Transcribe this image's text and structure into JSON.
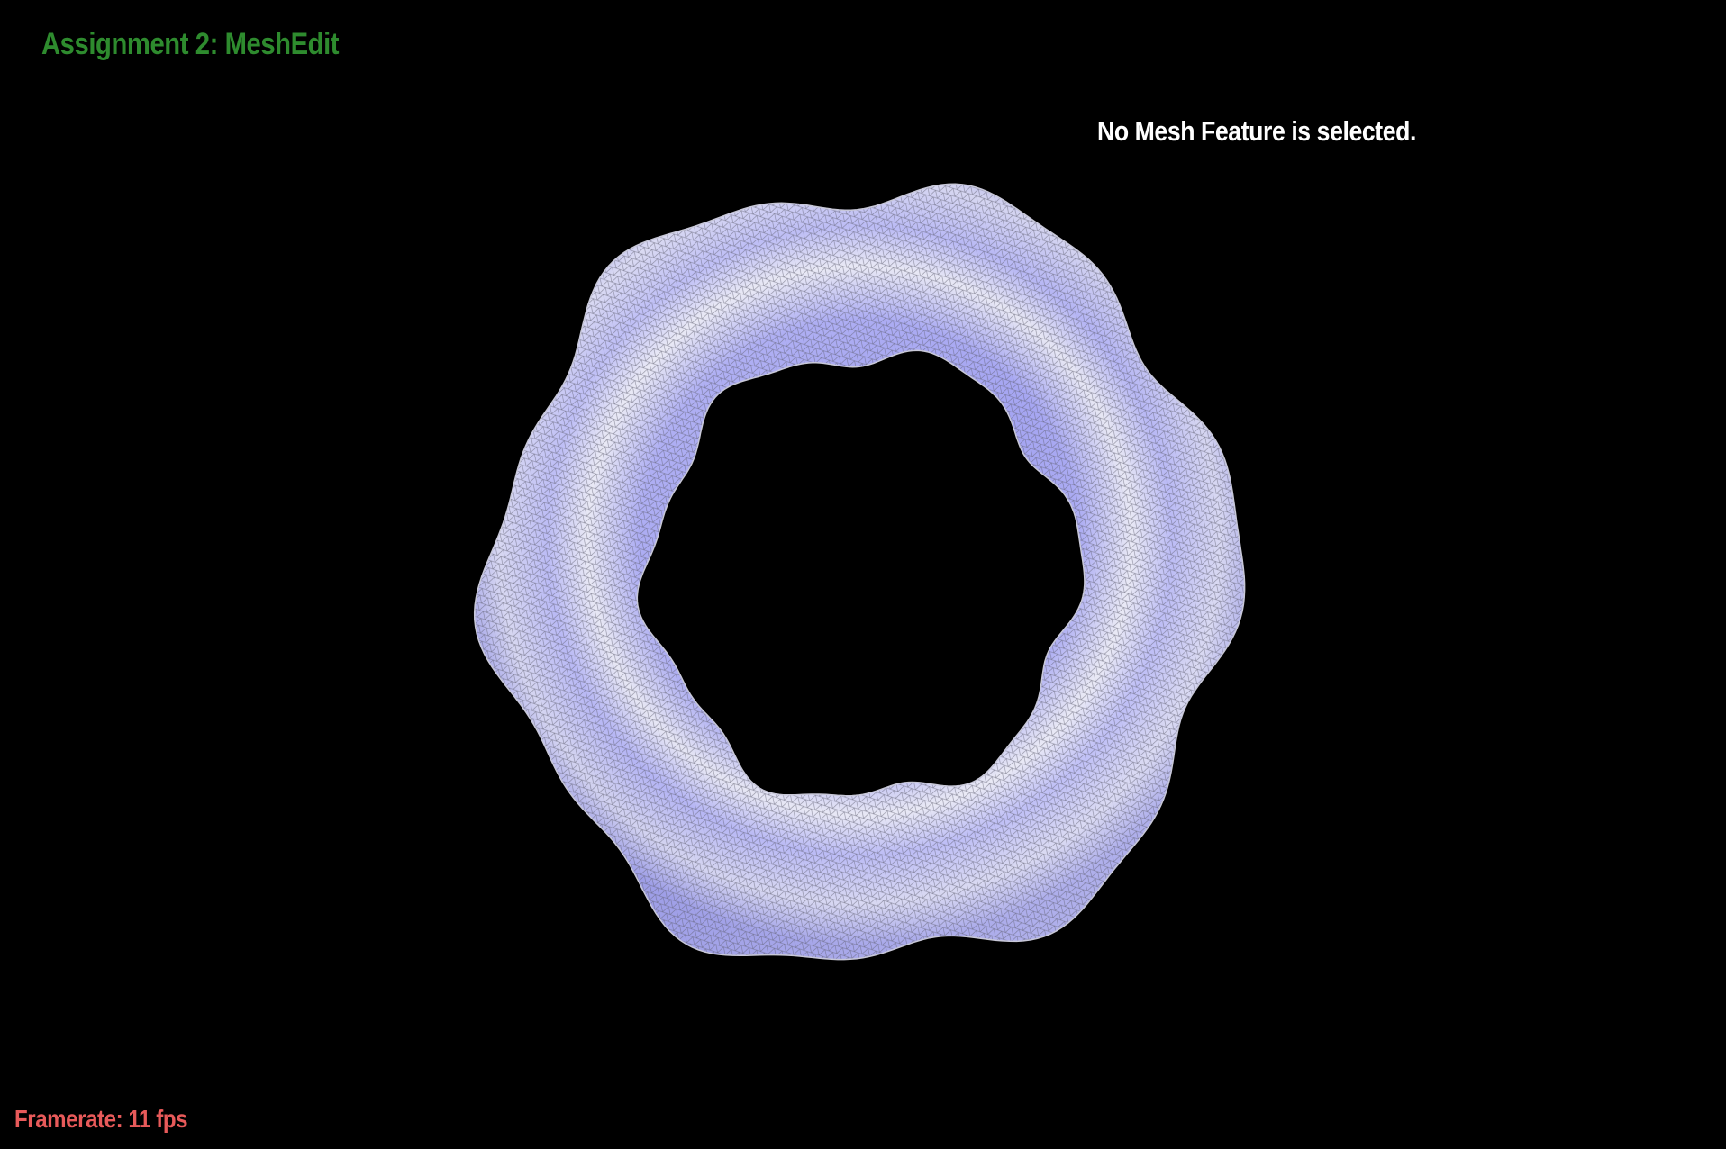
{
  "app": {
    "title": "Assignment 2: MeshEdit"
  },
  "status": {
    "selection_message": "No Mesh Feature is selected.",
    "framerate_text": "Framerate: 11 fps"
  },
  "colors": {
    "background": "#000000",
    "title": "#2e8b2e",
    "selection_message": "#ffffff",
    "framerate": "#e85a5a",
    "mesh_base": "#9c9cf0",
    "mesh_highlight": "#f2f2f8",
    "wireframe": "#6a6a7a"
  },
  "viewport": {
    "object": "torus-mesh",
    "render_mode": "shaded-wireframe"
  }
}
